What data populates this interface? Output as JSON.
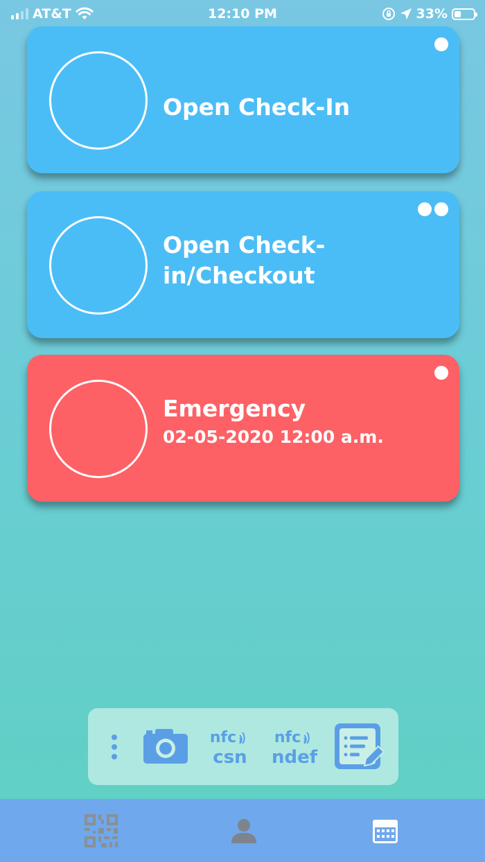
{
  "status_bar": {
    "carrier": "AT&T",
    "time": "12:10 PM",
    "battery": "33%",
    "battery_level": 0.33
  },
  "cards": [
    {
      "title": "Open Check-In",
      "subtitle": "",
      "color": "#4bbdf6",
      "dot_count": 1
    },
    {
      "title": "Open Check-in/Checkout",
      "subtitle": "",
      "color": "#4bbdf6",
      "dot_count": 2
    },
    {
      "title": "Emergency",
      "subtitle": "02-05-2020 12:00 a.m.",
      "color": "#fd6165",
      "dot_count": 1
    }
  ],
  "toolbar": {
    "items": [
      {
        "icon": "more-vertical-icon"
      },
      {
        "icon": "camera-icon"
      },
      {
        "icon": "nfc-csn-icon",
        "top": "nfc",
        "bottom": "csn"
      },
      {
        "icon": "nfc-ndef-icon",
        "top": "nfc",
        "bottom": "ndef"
      },
      {
        "icon": "edit-form-icon"
      }
    ],
    "accent": "#5a9fe6"
  },
  "tabbar": {
    "color": "#6fa8ec",
    "tabs": [
      {
        "icon": "qr-code-icon"
      },
      {
        "icon": "user-icon"
      },
      {
        "icon": "calendar-icon"
      }
    ]
  }
}
